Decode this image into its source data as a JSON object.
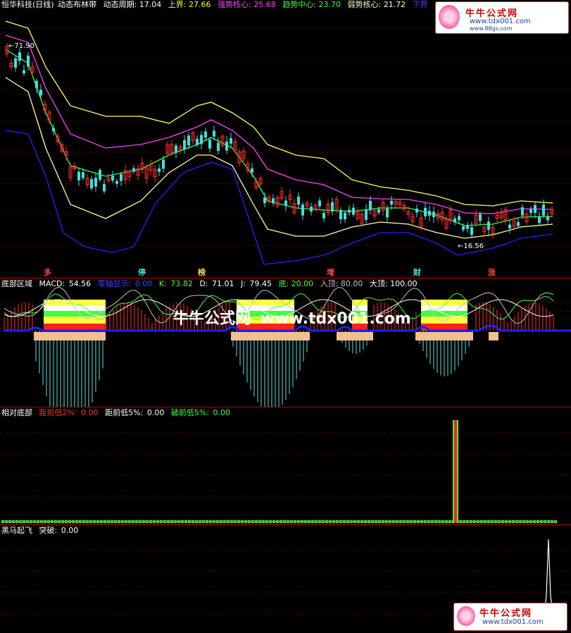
{
  "colors": {
    "up": "#ff3030",
    "down": "#40e0e0",
    "upper": "#ffff60",
    "strong": "#ff40ff",
    "trend": "#40ff40",
    "weak": "#ffffa0",
    "lower": "#2020ff",
    "bg": "#000000",
    "grid": "#b00000"
  },
  "main": {
    "title": "恒华科技(日线)",
    "indicator": "动态布林带",
    "period_label": "动态周期:",
    "period_value": "17.04",
    "upper_label": "上界:",
    "upper_value": "27.66",
    "strong_label": "强势核心:",
    "strong_value": "25.68",
    "trend_label": "趋势中心:",
    "trend_value": "23.70",
    "weak_label": "弱势核心:",
    "weak_value": "21.72",
    "lower_label": "下界",
    "high_marker": "71.90",
    "low_marker": "16.56",
    "events": [
      "多",
      "停",
      "榜",
      "增",
      "财",
      "涨"
    ]
  },
  "bottom_zone": {
    "title": "底部区域",
    "macd_label": "MACD:",
    "macd_value": "54.56",
    "zero_label": "零轴显示:",
    "zero_value": "0.00",
    "k_label": "K:",
    "k_value": "73.82",
    "d_label": "D:",
    "d_value": "71.01",
    "j_label": "J:",
    "j_value": "79.45",
    "di_label": "底:",
    "di_value": "20.00",
    "entry_label": "入顶:",
    "entry_value": "80.00",
    "top_label": "大顶:",
    "top_value": "100.00"
  },
  "relative_bottom": {
    "title": "相对底部",
    "l1": "距前低2%:",
    "v1": "0.00",
    "l2": "距前低5%:",
    "v2": "0.00",
    "l3": "破前低5%:",
    "v3": "0.00"
  },
  "dark_horse": {
    "title": "黑马起飞",
    "label": "突破:",
    "value": "0.00"
  },
  "watermark": {
    "name": "牛牛公式网",
    "url": "www.tdx001.com",
    "url2": "www.88gs.com",
    "overlay_a": "牛牛公式网",
    "overlay_b": "www.tdx001.com"
  }
}
